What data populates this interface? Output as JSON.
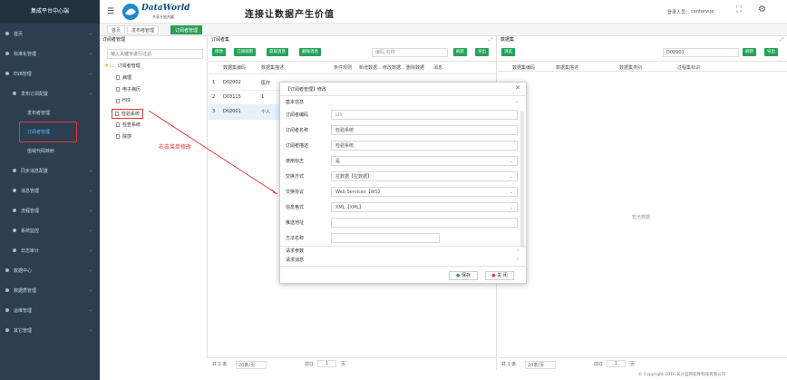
{
  "app": {
    "title": "集成平台中心端",
    "brand_main": "DataWorld",
    "brand_sub": "共享开放共赢",
    "slogan": "连接让数据产生价值",
    "login_label": "登录人员：",
    "user": "centervue"
  },
  "sidebar": {
    "items": [
      {
        "label": "首页"
      },
      {
        "label": "标准化管理"
      },
      {
        "label": "ESB管理"
      },
      {
        "label": "发布订阅配置"
      },
      {
        "label": "发布者管理"
      },
      {
        "label": "订阅者管理"
      },
      {
        "label": "值域代码映射"
      },
      {
        "label": "同步消息配置"
      },
      {
        "label": "消息管理"
      },
      {
        "label": "流程管理"
      },
      {
        "label": "系统监控"
      },
      {
        "label": "日志审计"
      },
      {
        "label": "数据中心"
      },
      {
        "label": "数据质管理"
      },
      {
        "label": "运维管理"
      },
      {
        "label": "其它管理"
      }
    ]
  },
  "tabs": [
    {
      "label": "首页"
    },
    {
      "label": "发布者管理"
    },
    {
      "label": "订阅者管理"
    }
  ],
  "tree": {
    "title": "订阅者管理",
    "search_placeholder": "输入关键字进行过滤",
    "root": "订阅者管理",
    "nodes": [
      "病理",
      "电子病历",
      "HIS",
      "检验系统",
      "检查系统",
      "院感"
    ],
    "annotation": "右击菜单修改"
  },
  "middle": {
    "title": "订阅者集",
    "buttons": [
      "修改",
      "订阅规则",
      "获取消息",
      "删除消息"
    ],
    "search_placeholder": "编码,名称",
    "refresh": "刷新",
    "export": "导出",
    "columns": [
      "数据集编码",
      "数据集描述",
      "条件规则",
      "新增数据...",
      "修改数据...",
      "删除数据",
      "消息"
    ],
    "rows": [
      {
        "n": "1",
        "code": "D02002",
        "desc": "医疗"
      },
      {
        "n": "2",
        "code": "D03115",
        "desc": "1"
      },
      {
        "n": "3",
        "code": "D02001",
        "desc": "个人"
      }
    ],
    "footer": {
      "total": "共 2 条",
      "per_page": "20条/页",
      "goto": "前往",
      "page": "1",
      "page_suffix": "页"
    }
  },
  "right": {
    "title": "数据集",
    "browse": "浏览",
    "search_value": "D02001",
    "refresh": "刷新",
    "export": "导出",
    "columns": [
      "数据集编码",
      "数据集描述",
      "数据集类别",
      "过程集标识"
    ],
    "empty": "暂无数据",
    "footer": {
      "total": "共 1 条",
      "per_page": "20条/页",
      "goto": "前往",
      "page": "1",
      "page_suffix": "页"
    }
  },
  "dialog": {
    "title": "【订阅者管理】修改",
    "section": "基本信息",
    "fields": [
      {
        "label": "订阅者编码",
        "value": "LIS"
      },
      {
        "label": "订阅者名称",
        "value": "检验系统"
      },
      {
        "label": "订阅者描述",
        "value": "检验系统"
      },
      {
        "label": "使用标志",
        "value": "是"
      },
      {
        "label": "交换方式",
        "value": "拉数据【拉数据】"
      },
      {
        "label": "交换协议",
        "value": "Web Services【WS】"
      },
      {
        "label": "信息格式",
        "value": "XML【XML】"
      },
      {
        "label": "推送地址",
        "value": ""
      },
      {
        "label": "方法名称",
        "value": ""
      }
    ],
    "request_params": "请求参数",
    "request_msg": "请求消息",
    "save": "保存",
    "close": "关 闭"
  },
  "copyright": "© Copyright 2016 长沙蓝所软件科技有限公司"
}
